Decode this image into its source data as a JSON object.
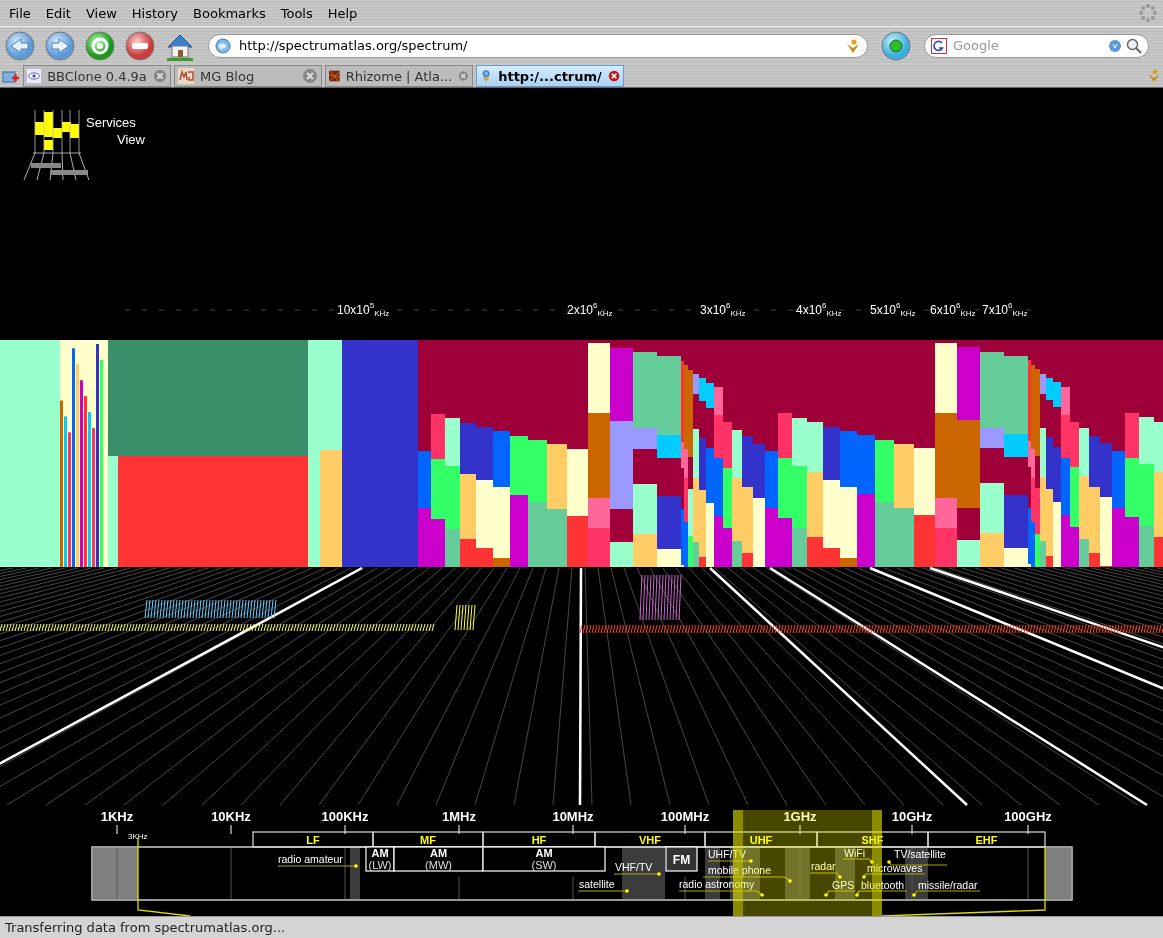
{
  "menu": [
    {
      "label": "File"
    },
    {
      "label": "Edit"
    },
    {
      "label": "View"
    },
    {
      "label": "History"
    },
    {
      "label": "Bookmarks"
    },
    {
      "label": "Tools"
    },
    {
      "label": "Help"
    }
  ],
  "toolbar": {
    "url": "http://spectrumatlas.org/spectrum/",
    "search": {
      "placeholder": "Google"
    }
  },
  "tabs": [
    {
      "label": "BBClone 0.4.9a",
      "selected": false
    },
    {
      "label": "MG Blog",
      "selected": false
    },
    {
      "label": "Rhizome | Atla...",
      "selected": false
    },
    {
      "label": "http:/...ctrum/",
      "selected": true
    }
  ],
  "logo": {
    "line_1": "Services",
    "line_2": "View"
  },
  "top_axis": {
    "ticks": [
      {
        "base": "10x10",
        "exponent": "5",
        "unit": "KHz"
      },
      {
        "base": "2x10",
        "exponent": "6",
        "unit": "KHz"
      },
      {
        "base": "3x10",
        "exponent": "6",
        "unit": "KHz"
      },
      {
        "base": "4x10",
        "exponent": "6",
        "unit": "KHz"
      },
      {
        "base": "5x10",
        "exponent": "6",
        "unit": "KHz"
      },
      {
        "base": "6x10",
        "exponent": "6",
        "unit": "KHz"
      },
      {
        "base": "7x10",
        "exponent": "6",
        "unit": "KHz"
      }
    ]
  },
  "bottom_axis": {
    "ticks": [
      "1KHz",
      "10KHz",
      "100KHz",
      "1MHz",
      "10MHz",
      "100MHz",
      "1GHz",
      "10GHz",
      "100GHz"
    ],
    "marker": "3KHz"
  },
  "bands": [
    {
      "label": "LF"
    },
    {
      "label": "MF"
    },
    {
      "label": "HF"
    },
    {
      "label": "VHF"
    },
    {
      "label": "UHF"
    },
    {
      "label": "SHF"
    },
    {
      "label": "EHF"
    }
  ],
  "broadcast": [
    {
      "kind": "am",
      "label": "AM",
      "detail": "(LW)"
    },
    {
      "kind": "am",
      "label": "AM",
      "detail": "(MW)"
    },
    {
      "kind": "am",
      "label": "AM",
      "detail": "(SW)"
    },
    {
      "kind": "fm",
      "label": "FM"
    }
  ],
  "services": [
    {
      "label": "radio amateur"
    },
    {
      "label": "VHF/TV"
    },
    {
      "label": "satellite"
    },
    {
      "label": "UHF/TV"
    },
    {
      "label": "mobile phone"
    },
    {
      "label": "radio astronomy"
    },
    {
      "label": "radar"
    },
    {
      "label": "WiFi"
    },
    {
      "label": "TV/satellite"
    },
    {
      "label": "microwaves"
    },
    {
      "label": "GPS"
    },
    {
      "label": "bluetooth"
    },
    {
      "label": "missile/radar"
    }
  ],
  "status_bar": {
    "text": "Transferring data from spectrumatlas.org..."
  }
}
